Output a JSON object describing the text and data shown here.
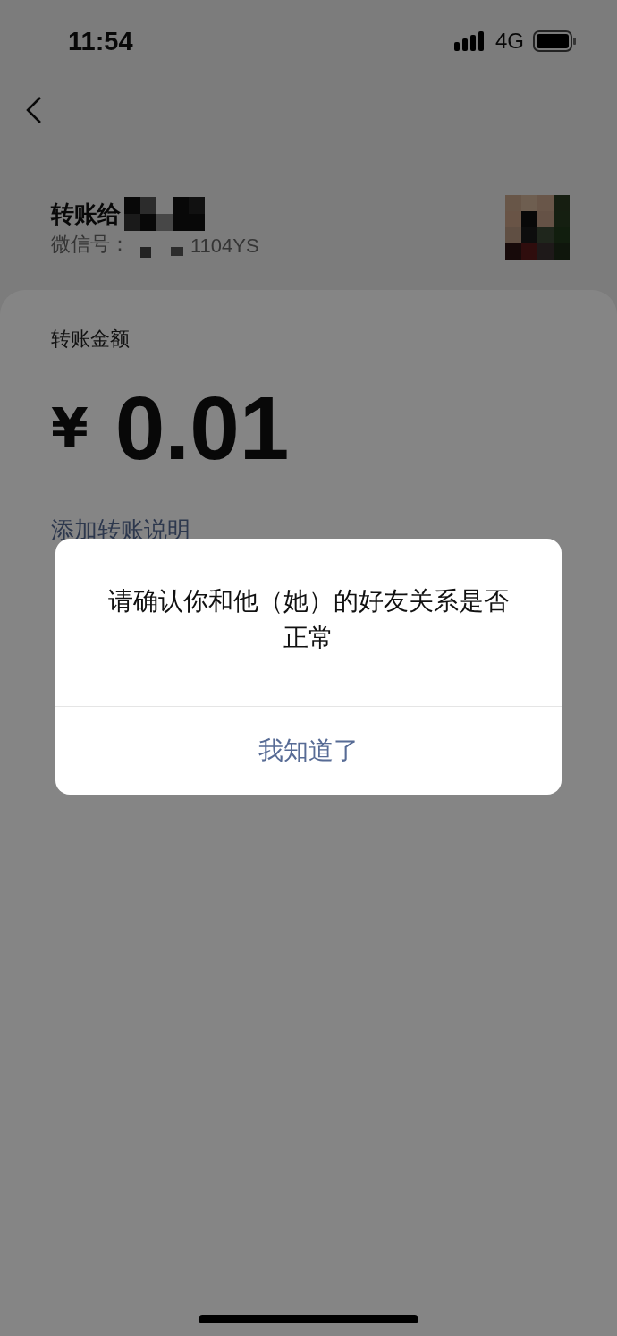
{
  "status_bar": {
    "time": "11:54",
    "network": "4G"
  },
  "recipient": {
    "title": "转账给",
    "id_label": "微信号：",
    "id_suffix": "1104YS"
  },
  "amount": {
    "label": "转账金额",
    "currency": "¥",
    "value": "0.01"
  },
  "note_link": "添加转账说明",
  "dialog": {
    "message": "请确认你和他（她）的好友关系是否正常",
    "button": "我知道了"
  }
}
